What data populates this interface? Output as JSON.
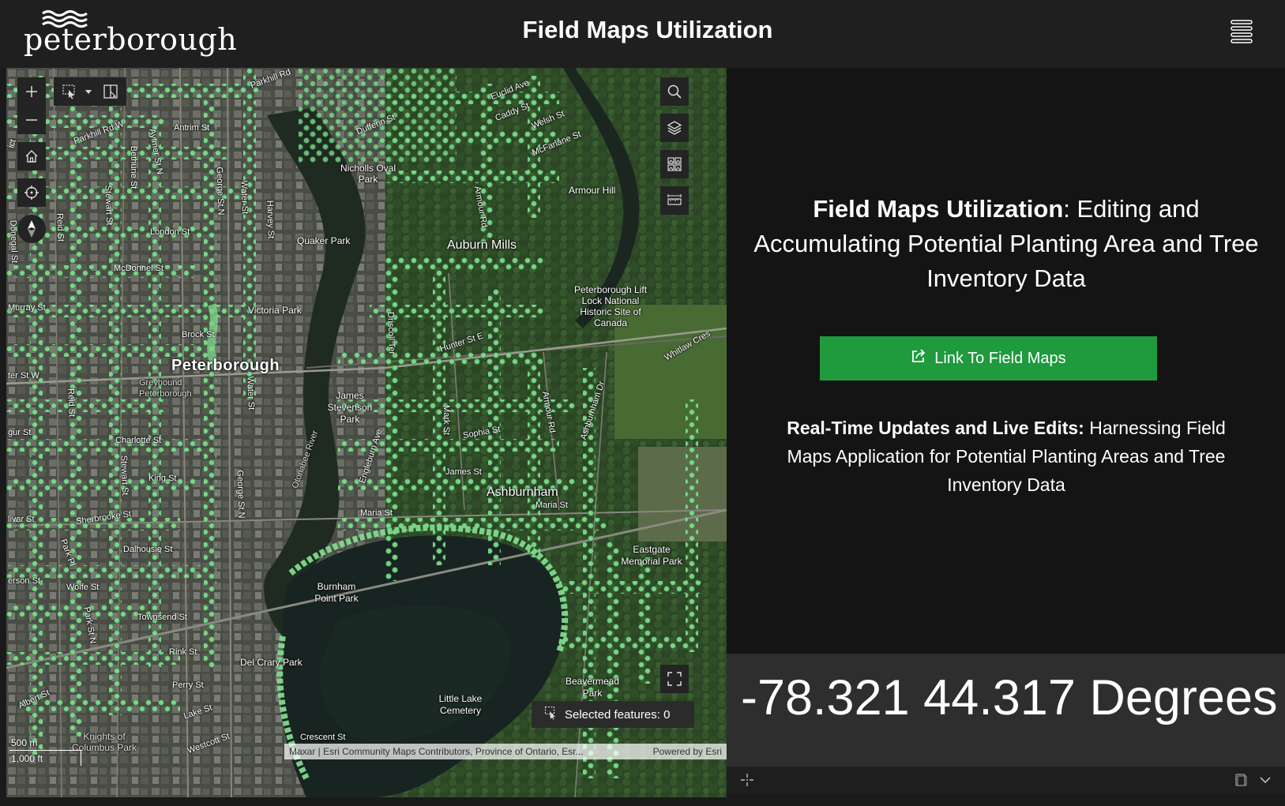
{
  "header": {
    "logo_text": "peterborough",
    "title": "Field Maps Utilization",
    "menu_icon": "menu-icon"
  },
  "map": {
    "toolbar_left": [
      "zoom-in-icon",
      "zoom-out-icon",
      "home-icon",
      "locate-icon",
      "compass-icon"
    ],
    "toolbar_top": [
      "select-icon",
      "dropdown-icon",
      "selection-toolbox-icon"
    ],
    "toolbar_right": [
      "search-icon",
      "layers-icon",
      "basemap-gallery-icon",
      "measure-icon"
    ],
    "fullscreen_icon": "fullscreen-icon",
    "selected_features": "Selected features: 0",
    "scale_metric": "500 m",
    "scale_imperial": "1,000 ft",
    "attribution": "Maxar | Esri Community Maps Contributors, Province of Ontario, Esr...",
    "powered_by": "Powered by Esri",
    "labels": {
      "peterborough": "Peterborough",
      "auburn_mills": "Auburn Mills",
      "ashburnham": "Ashburnham",
      "nicholls_oval_park": "Nicholls Oval Park",
      "quaker_park": "Quaker Park",
      "victoria_park": "Victoria Park",
      "armour_hill": "Armour Hill",
      "lift_lock": "Peterborough Lift Lock National Historic Site of Canada",
      "james_stevenson_park": "James Stevenson Park",
      "greyhound": "Greyhound Peterborough",
      "burnham_point_park": "Burnham Point Park",
      "del_crary_park": "Del Crary Park",
      "eastgate_memorial_park": "Eastgate Memorial Park",
      "beavermead_park": "Beavermead Park",
      "little_lake_cemetery": "Little Lake Cemetery",
      "knights_of_columbus_park": "Knights of Columbus Park",
      "otonabee_river": "Otonabee River",
      "parkhill_rd": "Parkhill Rd",
      "parkhill_rd_w": "Parkhill Rd W",
      "antrim_st": "Antrim St",
      "dufferin_st": "Dufferin St",
      "euclid_ave": "Euclid Ave",
      "caddy_st": "Caddy St",
      "welsh_st": "Welsh St",
      "mcfarlane_st": "McFarlane St",
      "london_st": "London St",
      "mcdonnel_st": "McDonnel St",
      "murray_st": "Murray St",
      "brock_st": "Brock St",
      "hunter_st_e": "Hunter St E",
      "charlotte_st": "Charlotte St",
      "king_st": "King St",
      "sherbrooke_st": "Sherbrooke St",
      "dalhousie_st": "Dalhousie St",
      "wolfe_st": "Wolfe St",
      "townsend_st": "Townsend St",
      "rink_st": "Rink St",
      "perry_st": "Perry St",
      "albert_st": "Albert St",
      "lake_st": "Lake St",
      "westcott_st": "Westcott St",
      "crescent_st": "Crescent St",
      "sophia_st": "Sophia St",
      "james_st": "James St",
      "maria_st": "Maria St",
      "maria_st_2": "Maria St",
      "bethune_st": "Bethune St",
      "aylmer_st": "Aylmer St N",
      "george_st": "George St N",
      "water_st": "Water St",
      "harvey_st": "Harvey St",
      "stewart_st": "Stewart St",
      "reid_st": "Reid St",
      "donegal_st": "Donegal St",
      "armour_rd": "Armour Rd",
      "driscoll_ter": "Driscoll Ter",
      "mark_st": "Mark St",
      "ashburnham_dr": "Ashburnham Dr",
      "engleburn_ave": "Engleburn Ave",
      "whitlaw_cres": "Whitlaw Cres",
      "water_st_2": "Water St",
      "park_st": "Park St N",
      "reid_st_2": "Reid St",
      "stewart_st_2": "Stewart St",
      "george_st_2": "George St N",
      "park_pl": "Park Pl",
      "hunter_st_w": "ter St W",
      "livar_st": "livar St",
      "erson_st": "erson St",
      "armour_rd_2": "Armour Rd",
      "ict": "ict",
      "gurst": "gur St"
    }
  },
  "panel": {
    "heading_bold": "Field Maps Utilization",
    "heading_rest": ": Editing and Accumulating Potential Planting Area and Tree Inventory Data",
    "link_button": "Link To Field Maps",
    "sub_bold": "Real-Time Updates and Live Edits:",
    "sub_rest": " Harnessing Field Maps Application for Potential Planting Areas and Tree Inventory Data"
  },
  "coords": {
    "text": "-78.321 44.317 Degrees"
  },
  "colors": {
    "link_button": "#1f9a3d",
    "tree_points": "#7fdc8e"
  }
}
